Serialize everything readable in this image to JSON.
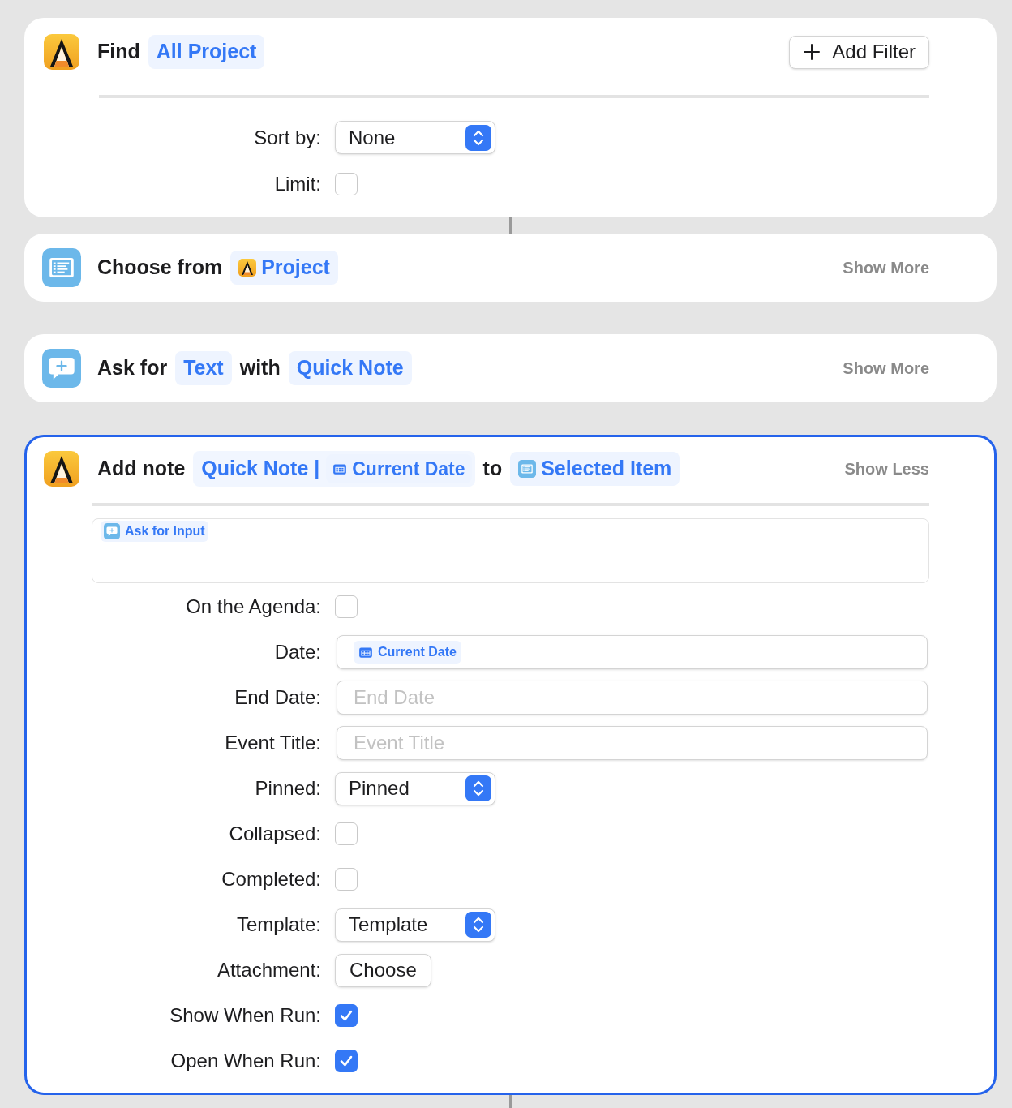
{
  "actions": [
    {
      "kind": "find",
      "selected": false,
      "header": [
        {
          "kind": "word",
          "text": "Find"
        },
        {
          "kind": "token",
          "text": "All Project"
        }
      ],
      "add_filter": "Add Filter",
      "params": [
        {
          "kind": "select",
          "label": "Sort by:",
          "value": "None"
        },
        {
          "kind": "checkbox",
          "label": "Limit:",
          "checked": false
        }
      ]
    },
    {
      "kind": "choose",
      "selected": false,
      "header": [
        {
          "kind": "word",
          "text": "Choose from"
        },
        {
          "kind": "app_token",
          "text": "Project"
        }
      ],
      "toggle": "Show More"
    },
    {
      "kind": "ask",
      "selected": false,
      "header": [
        {
          "kind": "word",
          "text": "Ask for"
        },
        {
          "kind": "token",
          "text": "Text"
        },
        {
          "kind": "word",
          "text": "with"
        },
        {
          "kind": "token",
          "text": "Quick Note"
        }
      ],
      "toggle": "Show More"
    },
    {
      "kind": "add_note",
      "selected": true,
      "header": [
        {
          "kind": "word",
          "text": "Add note"
        },
        {
          "kind": "compound",
          "parts": [
            {
              "kind": "text",
              "text": "Quick Note |"
            },
            {
              "kind": "date_token",
              "text": "Current Date"
            }
          ]
        },
        {
          "kind": "word",
          "text": "to"
        },
        {
          "kind": "list_token",
          "text": "Selected Item"
        }
      ],
      "toggle": "Show Less",
      "body": {
        "kind": "ask_token",
        "text": "Ask for Input"
      },
      "params": [
        {
          "kind": "checkbox",
          "label": "On the Agenda:",
          "checked": false
        },
        {
          "kind": "field",
          "label": "Date:",
          "token": {
            "kind": "date_token",
            "text": "Current Date"
          }
        },
        {
          "kind": "field",
          "label": "End Date:",
          "placeholder": "End Date"
        },
        {
          "kind": "field",
          "label": "Event Title:",
          "placeholder": "Event Title"
        },
        {
          "kind": "select",
          "label": "Pinned:",
          "value": "Pinned"
        },
        {
          "kind": "checkbox",
          "label": "Collapsed:",
          "checked": false
        },
        {
          "kind": "checkbox",
          "label": "Completed:",
          "checked": false
        },
        {
          "kind": "select",
          "label": "Template:",
          "value": "Template"
        },
        {
          "kind": "button",
          "label": "Attachment:",
          "value": "Choose"
        },
        {
          "kind": "checkbox",
          "label": "Show When Run:",
          "checked": true
        },
        {
          "kind": "checkbox",
          "label": "Open When Run:",
          "checked": true
        }
      ]
    }
  ]
}
